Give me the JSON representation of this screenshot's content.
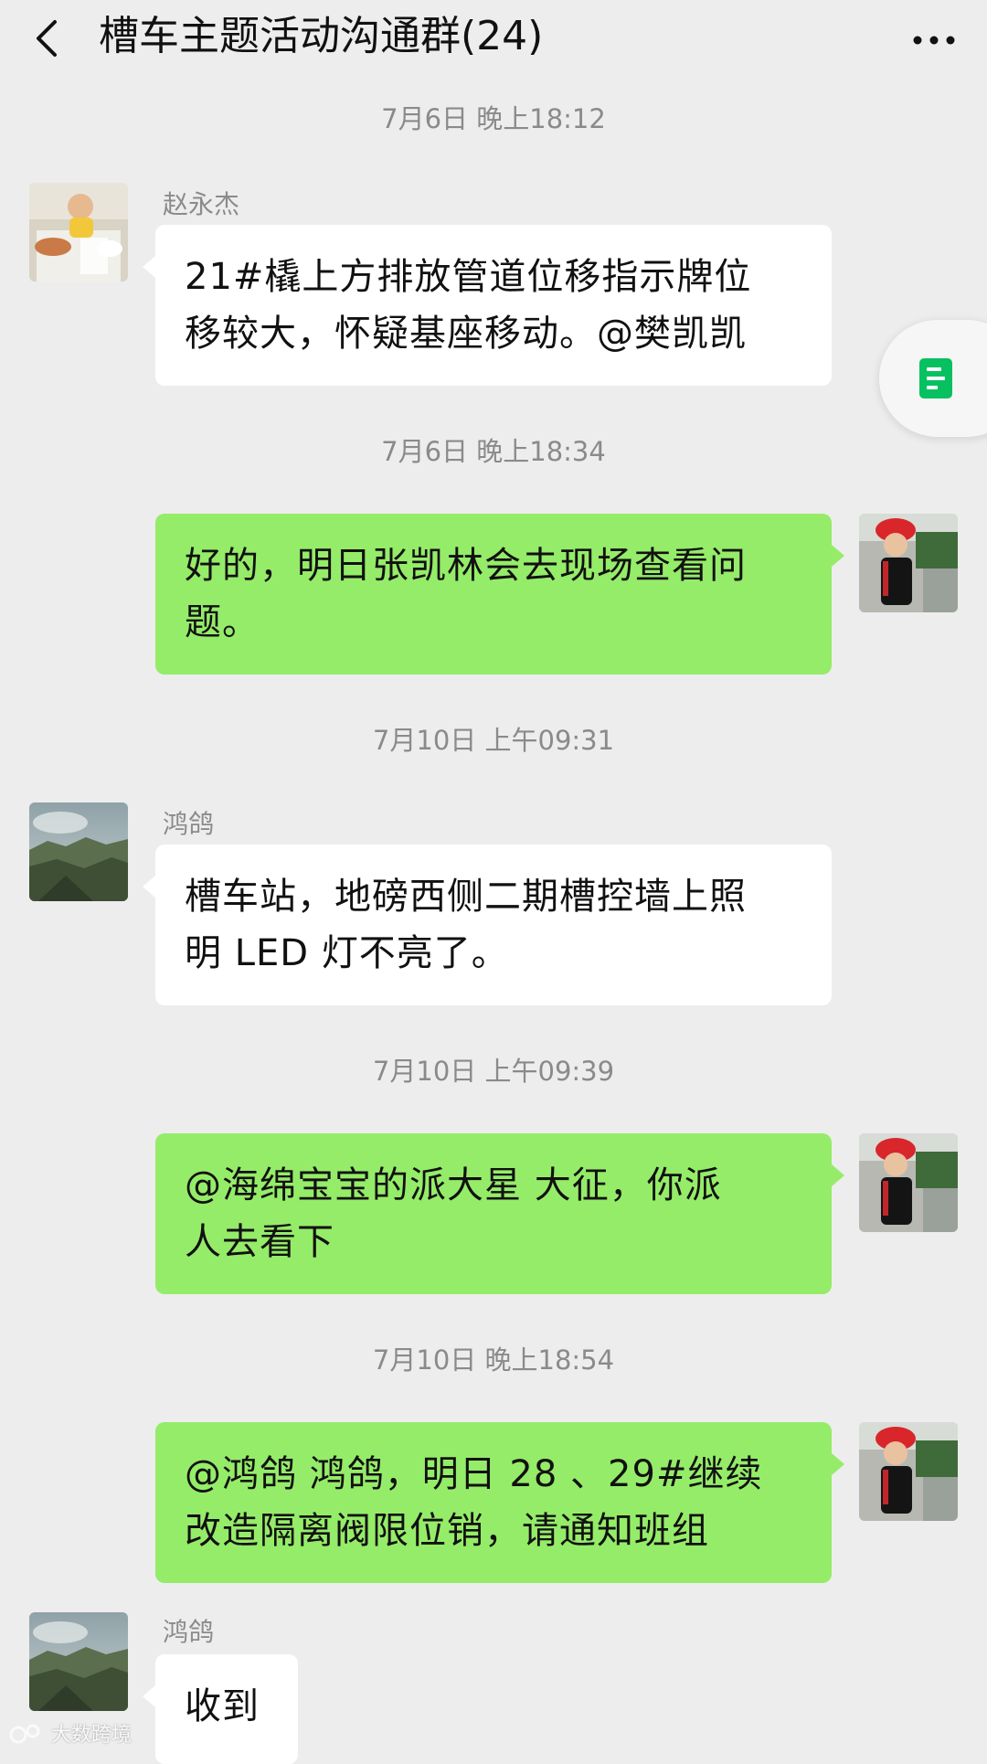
{
  "header": {
    "title": "槽车主题活动沟通群(24)",
    "back_icon": "chevron-left-icon",
    "more_icon": "more-dots-icon"
  },
  "messages": [
    {
      "timestamp": "7月6日 晚上18:12",
      "sender": "赵永杰",
      "direction": "incoming",
      "lines": [
        "21#橇上方排放管道位移指示牌位",
        "移较大，怀疑基座移动。@樊凯凯"
      ]
    },
    {
      "timestamp": "7月6日 晚上18:34",
      "sender": "",
      "direction": "outgoing",
      "lines": [
        "好的，明日张凯林会去现场查看问",
        "题。"
      ]
    },
    {
      "timestamp": "7月10日 上午09:31",
      "sender": "鸿鸽",
      "direction": "incoming",
      "lines": [
        "槽车站，地磅西侧二期槽控墙上照",
        "明 LED 灯不亮了。"
      ]
    },
    {
      "timestamp": "7月10日 上午09:39",
      "sender": "",
      "direction": "outgoing",
      "lines": [
        "@海绵宝宝的派大星  大征，你派",
        "人去看下"
      ]
    },
    {
      "timestamp": "7月10日 晚上18:54",
      "sender": "",
      "direction": "outgoing",
      "lines": [
        "@鸿鸽  鸿鸽，明日 28 、29#继续",
        "改造隔离阀限位销，请通知班组"
      ]
    },
    {
      "timestamp": "",
      "sender": "鸿鸽",
      "direction": "incoming",
      "lines": [
        "收到"
      ]
    }
  ],
  "floating_button": {
    "icon": "note-icon"
  },
  "watermark": {
    "text": "大数跨境"
  },
  "colors": {
    "background": "#ededed",
    "incoming_bubble": "#ffffff",
    "outgoing_bubble": "#95ec69",
    "timestamp_text": "#8a8a8a",
    "accent_green": "#07c160"
  }
}
